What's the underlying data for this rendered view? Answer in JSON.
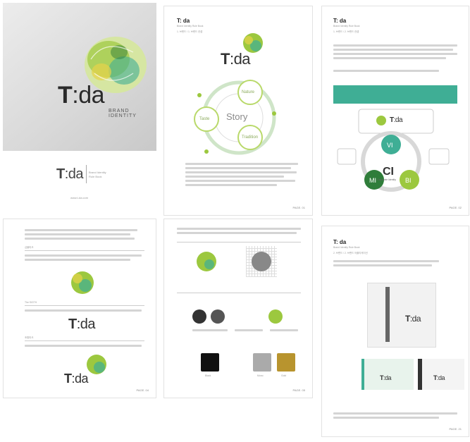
{
  "photo": {
    "logo_text_t": "T",
    "logo_text_da": ":da",
    "tagline": "BRAND IDENTITY"
  },
  "cover": {
    "logo_text_t": "T",
    "logo_text_da": ":da",
    "subtitle_line1": "Brand Identity",
    "subtitle_line2": "Rule Book",
    "footer": "www.t-da.com"
  },
  "page2": {
    "header": "T: da",
    "subheader": "Brand Identity Rule Book",
    "section": "1. 브랜드 / 1. 브랜드 컨셉",
    "circles": [
      "Nature",
      "Story",
      "Tradition",
      "Taste"
    ],
    "page_no": "PAGE. 01"
  },
  "page3": {
    "header": "T: da",
    "subheader": "Brand Identity Rule Book",
    "section": "1. 브랜드 / 2. 브랜드 컨셉",
    "ci": "CI",
    "ci_sub": "Corporate Identity",
    "vi": "VI",
    "mi": "MI",
    "bi": "BI",
    "page_no": "PAGE. 02"
  },
  "page4": {
    "label_a": "심볼마크",
    "label_b": "The SIGTH",
    "label_c": "조합마크",
    "page_no": "PAGE. 04"
  },
  "page5": {
    "label_color": "Color",
    "label_mono": "Mono",
    "label_gold": "Gold",
    "label_black": "Black",
    "page_no": "PAGE. 05"
  },
  "page6": {
    "header": "T: da",
    "subheader": "Brand Identity Rule Book",
    "section": "2. 브랜드 / 2. 브랜드 어플리케이션",
    "page_no": "PAGE. 21"
  },
  "colors": {
    "green_dark": "#2f7d3a",
    "green_light": "#9cc83f",
    "teal": "#3fae95",
    "yellow": "#e7d34a"
  }
}
